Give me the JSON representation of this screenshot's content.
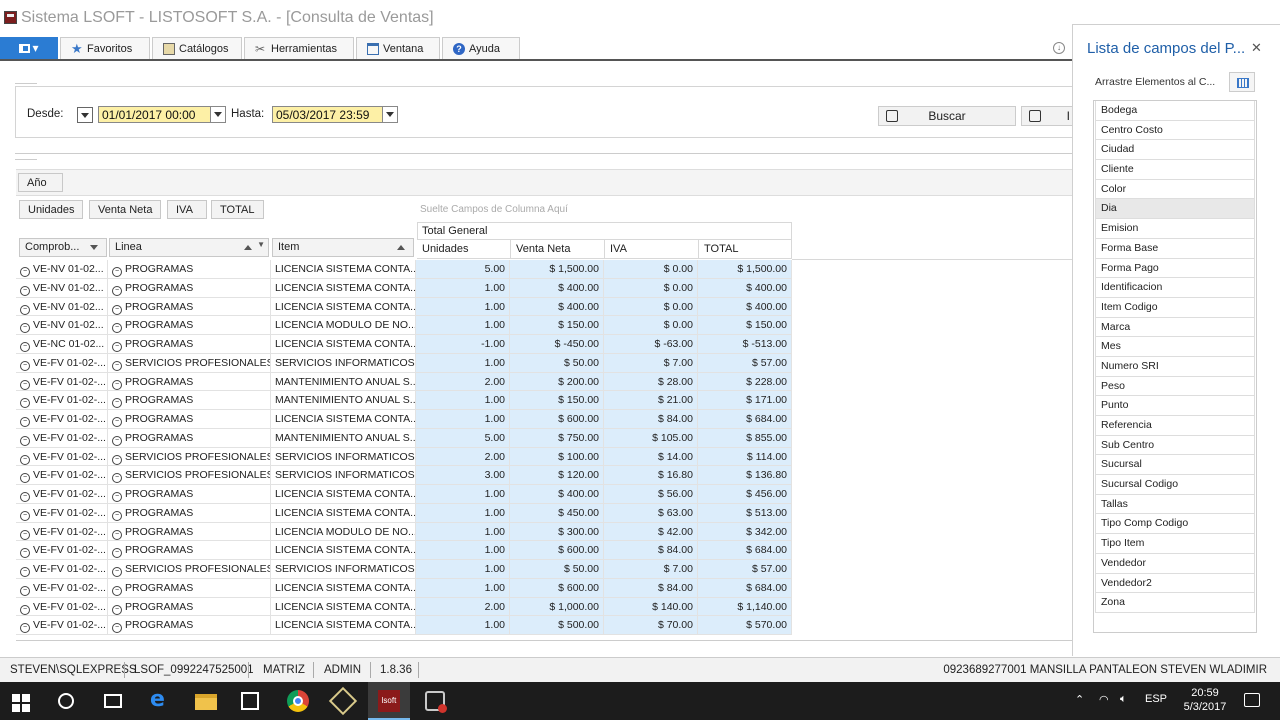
{
  "window": {
    "title": "Sistema LSOFT - LISTOSOFT S.A. - [Consulta de Ventas]",
    "controls": [
      "–",
      "⧉",
      "✕"
    ]
  },
  "menu": {
    "items": [
      {
        "label": "Favoritos",
        "icon": "star-icon"
      },
      {
        "label": "Catálogos",
        "icon": "book-icon"
      },
      {
        "label": "Herramientas",
        "icon": "tools-icon"
      },
      {
        "label": "Ventana",
        "icon": "window-icon"
      },
      {
        "label": "Ayuda",
        "icon": "help-icon"
      }
    ]
  },
  "filters": {
    "desde_label": "Desde:",
    "desde_value": "01/01/2017 00:00",
    "hasta_label": "Hasta:",
    "hasta_value": "05/03/2017 23:59",
    "search_label": "Buscar",
    "print_label": "I"
  },
  "pivot": {
    "filter_area_fields": [
      "Año"
    ],
    "data_fields": [
      "Unidades",
      "Venta Neta",
      "IVA",
      "TOTAL"
    ],
    "column_drop_hint": "Suelte Campos de Columna Aquí",
    "column_group": "Total General",
    "row_fields": [
      "Comprob...",
      "Linea",
      "Item"
    ],
    "data_headers": [
      "Unidades",
      "Venta Neta",
      "IVA",
      "TOTAL"
    ],
    "rows": [
      [
        "VE-NV 01-02...",
        "PROGRAMAS",
        "LICENCIA SISTEMA CONTA...",
        "5.00",
        "$ 1,500.00",
        "$ 0.00",
        "$ 1,500.00"
      ],
      [
        "VE-NV 01-02...",
        "PROGRAMAS",
        "LICENCIA SISTEMA CONTA...",
        "1.00",
        "$ 400.00",
        "$ 0.00",
        "$ 400.00"
      ],
      [
        "VE-NV 01-02...",
        "PROGRAMAS",
        "LICENCIA SISTEMA CONTA...",
        "1.00",
        "$ 400.00",
        "$ 0.00",
        "$ 400.00"
      ],
      [
        "VE-NV 01-02...",
        "PROGRAMAS",
        "LICENCIA MODULO DE NO...",
        "1.00",
        "$ 150.00",
        "$ 0.00",
        "$ 150.00"
      ],
      [
        "VE-NC 01-02...",
        "PROGRAMAS",
        "LICENCIA SISTEMA CONTA...",
        "-1.00",
        "$ -450.00",
        "$ -63.00",
        "$ -513.00"
      ],
      [
        "VE-FV 01-02-...",
        "SERVICIOS PROFESIONALES",
        "SERVICIOS INFORMATICOS",
        "1.00",
        "$ 50.00",
        "$ 7.00",
        "$ 57.00"
      ],
      [
        "VE-FV 01-02-...",
        "PROGRAMAS",
        "MANTENIMIENTO ANUAL S...",
        "2.00",
        "$ 200.00",
        "$ 28.00",
        "$ 228.00"
      ],
      [
        "VE-FV 01-02-...",
        "PROGRAMAS",
        "MANTENIMIENTO ANUAL S...",
        "1.00",
        "$ 150.00",
        "$ 21.00",
        "$ 171.00"
      ],
      [
        "VE-FV 01-02-...",
        "PROGRAMAS",
        "LICENCIA SISTEMA CONTA...",
        "1.00",
        "$ 600.00",
        "$ 84.00",
        "$ 684.00"
      ],
      [
        "VE-FV 01-02-...",
        "PROGRAMAS",
        "MANTENIMIENTO ANUAL S...",
        "5.00",
        "$ 750.00",
        "$ 105.00",
        "$ 855.00"
      ],
      [
        "VE-FV 01-02-...",
        "SERVICIOS PROFESIONALES",
        "SERVICIOS INFORMATICOS",
        "2.00",
        "$ 100.00",
        "$ 14.00",
        "$ 114.00"
      ],
      [
        "VE-FV 01-02-...",
        "SERVICIOS PROFESIONALES",
        "SERVICIOS INFORMATICOS",
        "3.00",
        "$ 120.00",
        "$ 16.80",
        "$ 136.80"
      ],
      [
        "VE-FV 01-02-...",
        "PROGRAMAS",
        "LICENCIA SISTEMA CONTA...",
        "1.00",
        "$ 400.00",
        "$ 56.00",
        "$ 456.00"
      ],
      [
        "VE-FV 01-02-...",
        "PROGRAMAS",
        "LICENCIA SISTEMA CONTA...",
        "1.00",
        "$ 450.00",
        "$ 63.00",
        "$ 513.00"
      ],
      [
        "VE-FV 01-02-...",
        "PROGRAMAS",
        "LICENCIA MODULO DE NO...",
        "1.00",
        "$ 300.00",
        "$ 42.00",
        "$ 342.00"
      ],
      [
        "VE-FV 01-02-...",
        "PROGRAMAS",
        "LICENCIA SISTEMA CONTA...",
        "1.00",
        "$ 600.00",
        "$ 84.00",
        "$ 684.00"
      ],
      [
        "VE-FV 01-02-...",
        "SERVICIOS PROFESIONALES",
        "SERVICIOS INFORMATICOS",
        "1.00",
        "$ 50.00",
        "$ 7.00",
        "$ 57.00"
      ],
      [
        "VE-FV 01-02-...",
        "PROGRAMAS",
        "LICENCIA SISTEMA CONTA...",
        "1.00",
        "$ 600.00",
        "$ 84.00",
        "$ 684.00"
      ],
      [
        "VE-FV 01-02-...",
        "PROGRAMAS",
        "LICENCIA SISTEMA CONTA...",
        "2.00",
        "$ 1,000.00",
        "$ 140.00",
        "$ 1,140.00"
      ],
      [
        "VE-FV 01-02-...",
        "PROGRAMAS",
        "LICENCIA SISTEMA CONTA...",
        "1.00",
        "$ 500.00",
        "$ 70.00",
        "$ 570.00"
      ]
    ]
  },
  "field_list": {
    "title": "Lista de campos del P...",
    "hint": "Arrastre Elementos al C...",
    "selected": "Dia",
    "fields": [
      "Bodega",
      "Centro Costo",
      "Ciudad",
      "Cliente",
      "Color",
      "Dia",
      "Emision",
      "Forma Base",
      "Forma Pago",
      "Identificacion",
      "Item Codigo",
      "Marca",
      "Mes",
      "Numero SRI",
      "Peso",
      "Punto",
      "Referencia",
      "Sub Centro",
      "Sucursal",
      "Sucursal Codigo",
      "Tallas",
      "Tipo Comp Codigo",
      "Tipo Item",
      "Vendedor",
      "Vendedor2",
      "Zona"
    ]
  },
  "statusbar": {
    "server": "STEVEN\\SQLEXPRESS",
    "license": "LSOF_0992247525001",
    "branch": "MATRIZ",
    "user": "ADMIN",
    "version": "1.8.36",
    "user_full": "0923689277001 MANSILLA PANTALEON STEVEN WLADIMIR"
  },
  "taskbar": {
    "lsoft_label": "lsoft",
    "lang": "ESP",
    "time": "20:59",
    "date": "5/3/2017"
  }
}
